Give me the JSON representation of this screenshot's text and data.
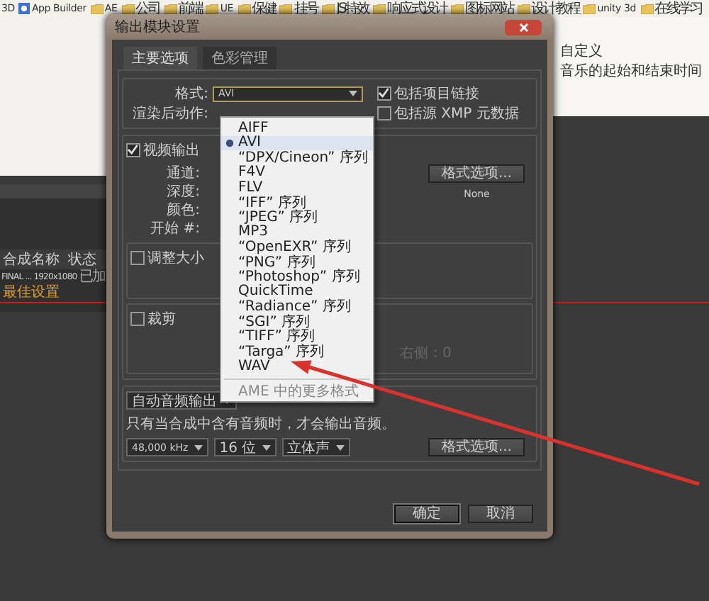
{
  "bookmarks": [
    {
      "label": "3D",
      "kind": "plain"
    },
    {
      "label": "App Builder",
      "kind": "app"
    },
    {
      "label": "AE",
      "kind": "folder"
    },
    {
      "label": "公司",
      "kind": "folder"
    },
    {
      "label": "前端",
      "kind": "folder"
    },
    {
      "label": "UE",
      "kind": "folder"
    },
    {
      "label": "保健",
      "kind": "folder"
    },
    {
      "label": "挂号",
      "kind": "folder"
    },
    {
      "label": "JS特效",
      "kind": "folder"
    },
    {
      "label": "响应式设计",
      "kind": "folder"
    },
    {
      "label": "图标网站",
      "kind": "folder"
    },
    {
      "label": "设计教程",
      "kind": "folder"
    },
    {
      "label": "unity 3d",
      "kind": "folder"
    },
    {
      "label": "在线学习",
      "kind": "folder"
    }
  ],
  "background_page": {
    "lines": [
      "自定义",
      "音乐的起始和结束时间"
    ]
  },
  "render_queue": {
    "columns": [
      "合成名称",
      "状态"
    ],
    "rows": [
      {
        "name": "FINAL ... 1920x1080",
        "status": "已加"
      }
    ],
    "settings": [
      "最佳设置"
    ]
  },
  "dialog": {
    "title": "输出模块设置",
    "tabs": [
      {
        "label": "主要选项",
        "selected": true
      },
      {
        "label": "色彩管理",
        "selected": false
      }
    ],
    "format": {
      "label": "格式:",
      "value": "AVI"
    },
    "post_render": {
      "label": "渲染后动作:"
    },
    "options": [
      {
        "label": "包括项目链接",
        "checked": true
      },
      {
        "label": "包括源 XMP 元数据",
        "checked": false
      }
    ],
    "video": {
      "label": "视频输出",
      "checked": true,
      "fields": [
        "通道:",
        "深度:",
        "颜色:",
        "开始 #:"
      ],
      "button": "格式选项...",
      "value": "None"
    },
    "resize": {
      "label": "调整大小",
      "checked": false
    },
    "crop": {
      "label": "裁剪",
      "checked": false,
      "right": "右侧：0"
    },
    "audio": {
      "mode": "自动音频输出",
      "note": "只有当合成中含有音频时，才会输出音频。",
      "selects": [
        "48,000 kHz",
        "16 位",
        "立体声"
      ],
      "button": "格式选项..."
    },
    "buttons": [
      {
        "label": "确定",
        "kind": "default"
      },
      {
        "label": "取消",
        "kind": "normal"
      }
    ]
  },
  "format_menu": {
    "items": [
      {
        "kind": "item",
        "label": "AIFF",
        "selected": false
      },
      {
        "kind": "item",
        "label": "AVI",
        "selected": true
      },
      {
        "kind": "item",
        "label": "“DPX/Cineon” 序列",
        "selected": false
      },
      {
        "kind": "item",
        "label": "F4V",
        "selected": false
      },
      {
        "kind": "item",
        "label": "FLV",
        "selected": false
      },
      {
        "kind": "item",
        "label": "“IFF” 序列",
        "selected": false
      },
      {
        "kind": "item",
        "label": "“JPEG” 序列",
        "selected": false
      },
      {
        "kind": "item",
        "label": "MP3",
        "selected": false
      },
      {
        "kind": "item",
        "label": "“OpenEXR” 序列",
        "selected": false
      },
      {
        "kind": "item",
        "label": "“PNG” 序列",
        "selected": false
      },
      {
        "kind": "item",
        "label": "“Photoshop” 序列",
        "selected": false
      },
      {
        "kind": "item",
        "label": "QuickTime",
        "selected": false
      },
      {
        "kind": "item",
        "label": "“Radiance” 序列",
        "selected": false
      },
      {
        "kind": "item",
        "label": "“SGI” 序列",
        "selected": false
      },
      {
        "kind": "item",
        "label": "“TIFF” 序列",
        "selected": false
      },
      {
        "kind": "item",
        "label": "“Targa” 序列",
        "selected": false
      },
      {
        "kind": "item",
        "label": "WAV",
        "selected": false
      },
      {
        "kind": "separator"
      },
      {
        "kind": "disabled",
        "label": "AME 中的更多格式",
        "selected": false
      }
    ]
  }
}
